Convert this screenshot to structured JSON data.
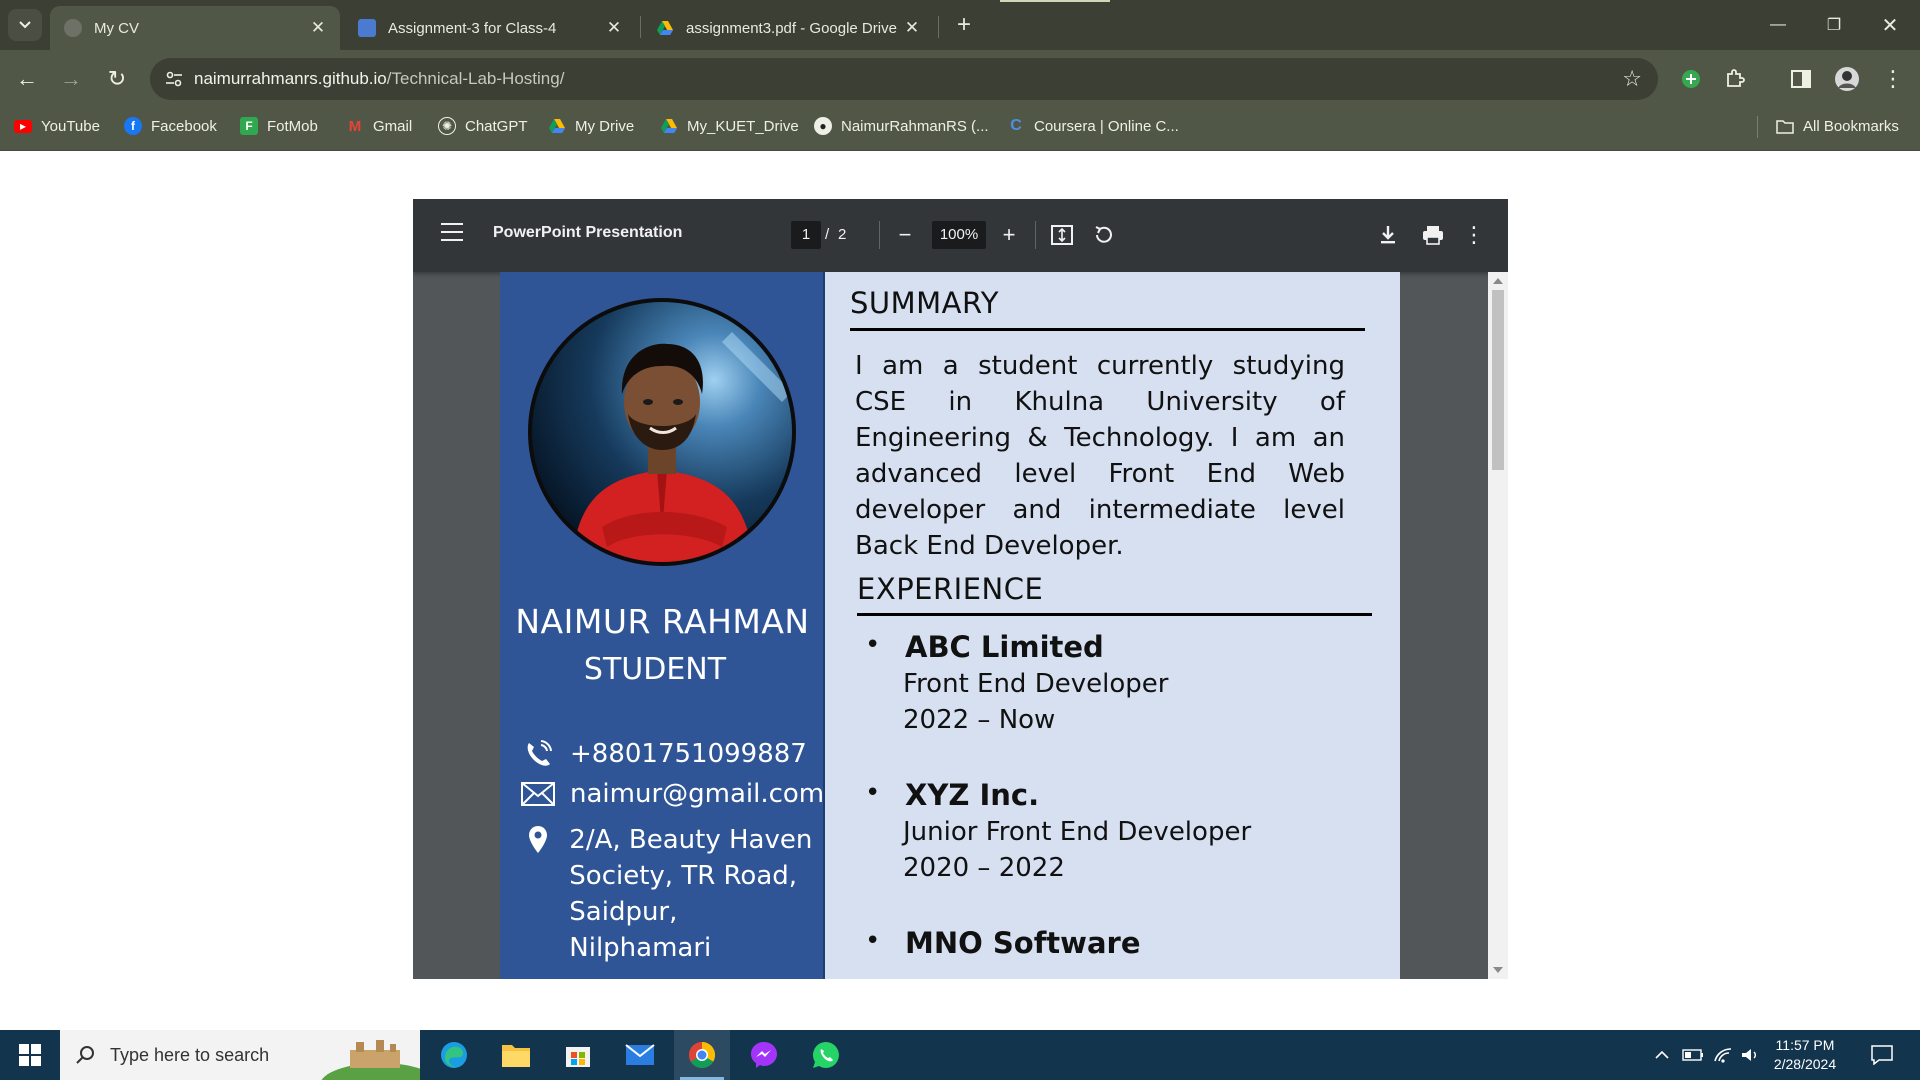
{
  "browser": {
    "tabs": [
      {
        "title": "My CV",
        "active": true
      },
      {
        "title": "Assignment-3 for Class-4",
        "active": false
      },
      {
        "title": "assignment3.pdf - Google Drive",
        "active": false
      }
    ],
    "address": {
      "host": "naimurrahmanrs.github.io",
      "path": "/Technical-Lab-Hosting/"
    },
    "bookmarks": [
      {
        "label": "YouTube",
        "icon": "youtube-icon",
        "color": "#ff0000"
      },
      {
        "label": "Facebook",
        "icon": "facebook-icon",
        "color": "#1877f2"
      },
      {
        "label": "FotMob",
        "icon": "fotmob-icon",
        "color": "#2fa84f"
      },
      {
        "label": "Gmail",
        "icon": "gmail-icon",
        "color": "#ea4335"
      },
      {
        "label": "ChatGPT",
        "icon": "chatgpt-icon",
        "color": "#ffffff"
      },
      {
        "label": "My Drive",
        "icon": "drive-icon",
        "color": "#fbbc04"
      },
      {
        "label": "My_KUET_Drive",
        "icon": "drive-icon",
        "color": "#fbbc04"
      },
      {
        "label": "NaimurRahmanRS (...",
        "icon": "github-icon",
        "color": "#ffffff"
      },
      {
        "label": "Coursera | Online C...",
        "icon": "coursera-icon",
        "color": "#2a73cc"
      }
    ],
    "all_bookmarks": "All Bookmarks"
  },
  "pdf_viewer": {
    "title": "PowerPoint Presentation",
    "page_current": "1",
    "page_separator": "/",
    "page_total": "2",
    "zoom": "100%"
  },
  "cv": {
    "name": "NAIMUR RAHMAN",
    "role": "STUDENT",
    "phone": "+8801751099887",
    "email": "naimur@gmail.com",
    "address_lines": [
      "2/A, Beauty Haven",
      "Society, TR Road,",
      "Saidpur, Nilphamari"
    ],
    "summary_heading": "SUMMARY",
    "summary_lines": [
      "I am a student currently studying CSE in Khulna University of Engineering & Technology. I am an advanced level Front End Web developer and intermediate level Back End Developer."
    ],
    "experience_heading": "EXPERIENCE",
    "experience": [
      {
        "company": "ABC Limited",
        "position": "Front End Developer",
        "years": "2022 – Now"
      },
      {
        "company": "XYZ Inc.",
        "position": "Junior Front End Developer",
        "years": "2020 – 2022"
      },
      {
        "company": "MNO Software",
        "position": "",
        "years": ""
      }
    ],
    "bullet": "•",
    "sidebar_color": "#2f5597",
    "main_color": "#d6e0f1"
  },
  "taskbar": {
    "search_placeholder": "Type here to search",
    "time": "11:57 PM",
    "date": "2/28/2024"
  }
}
